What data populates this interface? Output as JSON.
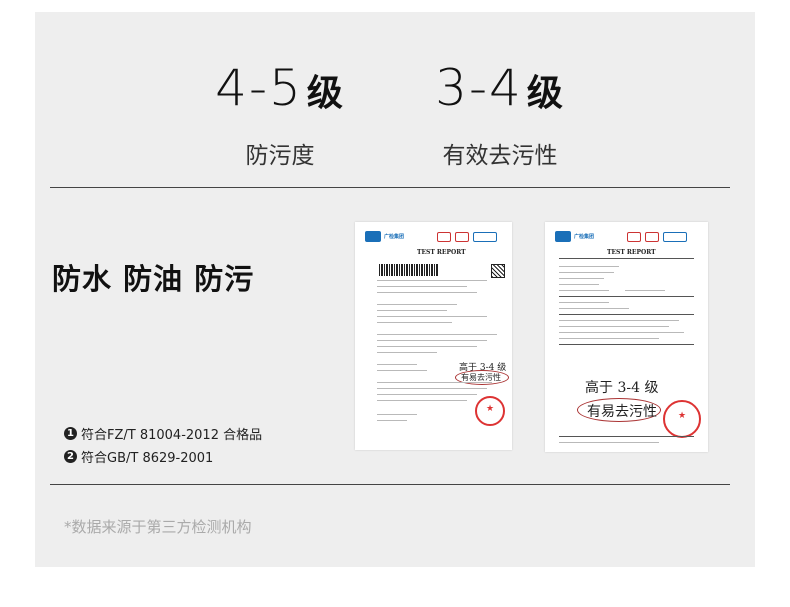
{
  "stats": [
    {
      "value": "4-5",
      "unit": "级",
      "label": "防污度"
    },
    {
      "value": "3-4",
      "unit": "级",
      "label": "有效去污性"
    }
  ],
  "title": "防水 防油 防污",
  "standards": [
    {
      "num": "1",
      "text": "符合FZ/T 81004-2012 合格品"
    },
    {
      "num": "2",
      "text": "符合GB/T 8629-2001"
    }
  ],
  "footnote": "*数据来源于第三方检测机构",
  "reports": {
    "org": "广检集团",
    "report_title": "TEST REPORT",
    "handwritten_line1": "高于 3-4 级",
    "handwritten_line2": "有易去污性"
  }
}
